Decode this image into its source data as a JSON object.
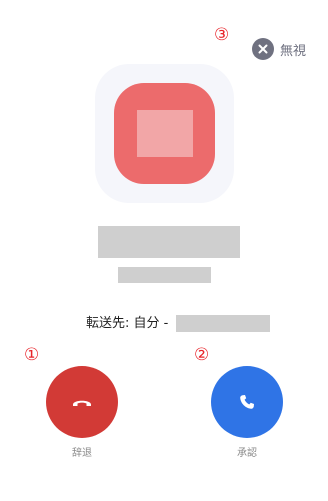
{
  "annotations": {
    "marker_1": "①",
    "marker_2": "②",
    "marker_3": "③"
  },
  "dismiss": {
    "label": "無視",
    "icon": "close-icon"
  },
  "app_icon": {
    "icon": "app-icon",
    "color": "#ec6b6c"
  },
  "forwarding": {
    "label": "転送先: 自分 -"
  },
  "actions": {
    "decline": {
      "label": "辞退",
      "icon": "phone-hangup-icon",
      "color": "#d23a36"
    },
    "accept": {
      "label": "承認",
      "icon": "phone-icon",
      "color": "#2f74e6"
    }
  }
}
